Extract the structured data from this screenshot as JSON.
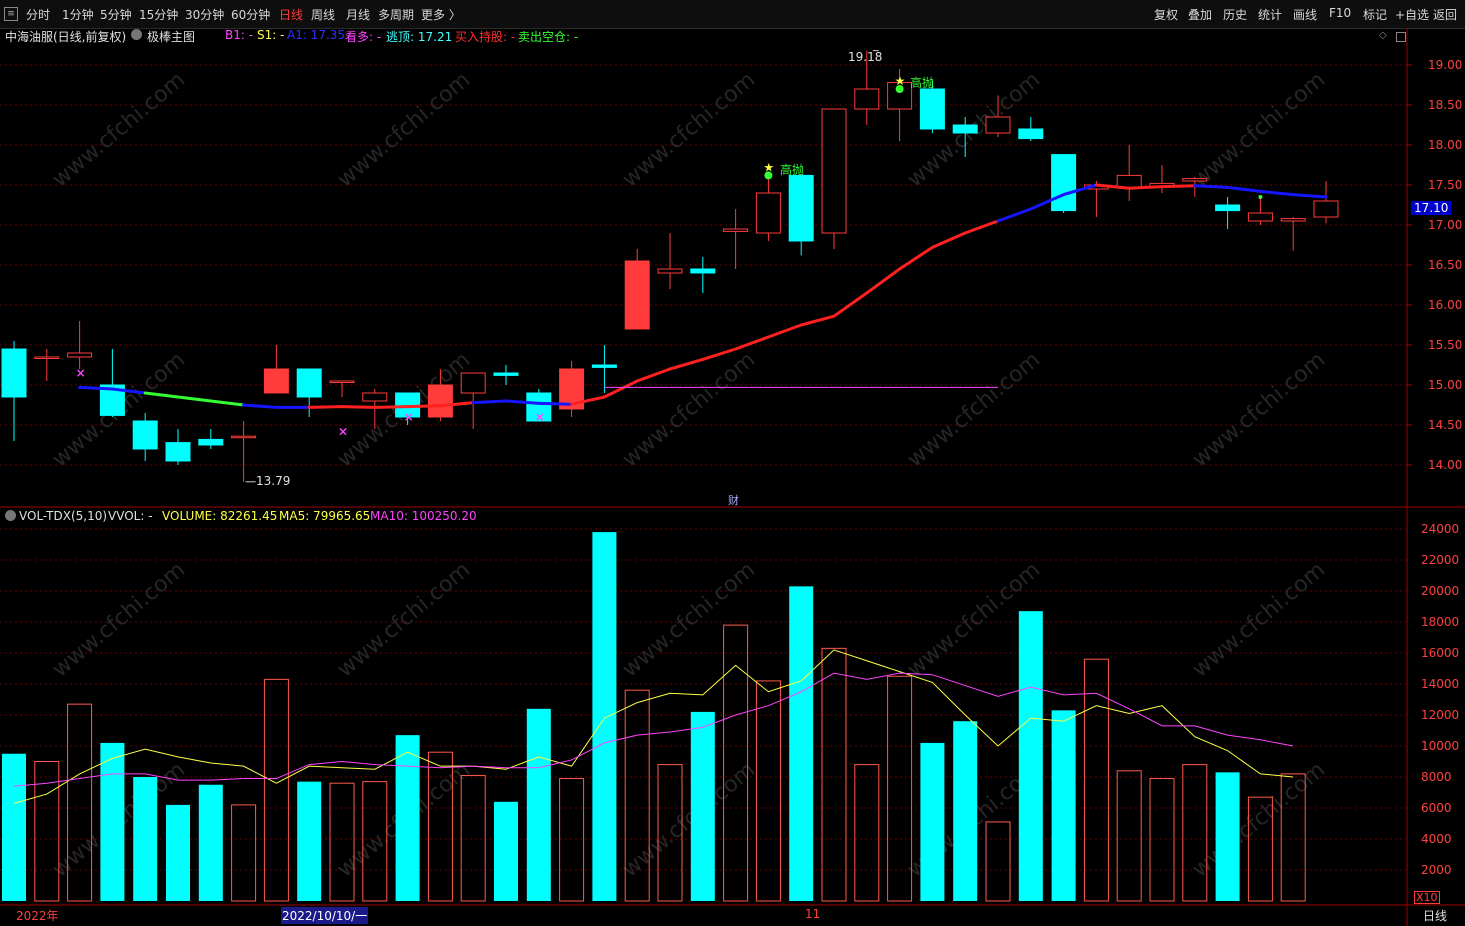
{
  "toolbar": {
    "periods": [
      "分时",
      "1分钟",
      "5分钟",
      "15分钟",
      "30分钟",
      "60分钟",
      "日线",
      "周线",
      "月线",
      "多周期",
      "更多 〉"
    ],
    "active_period": "日线",
    "right_buttons": [
      "复权",
      "叠加",
      "历史",
      "统计",
      "画线",
      "F10",
      "标记",
      "+自选",
      "返回"
    ]
  },
  "main_header": {
    "stock": "中海油服(日线,前复权)",
    "indicator": "极棒主图",
    "b1": "B1: -",
    "s1": "S1: -",
    "a1": "A1: 17.35",
    "kanduo": "看多: -",
    "taoding": "逃顶: 17.21",
    "buy_hold": "买入持股: -",
    "sell_empty": "卖出空仓: -"
  },
  "vol_header": {
    "name": "VOL-TDX(5,10)",
    "vvol": "VVOL: -",
    "volume": "VOLUME: 82261.45",
    "ma5": "MA5: 79965.65",
    "ma10": "MA10: 100250.20"
  },
  "colors": {
    "up": "#ff3b3b",
    "down": "#00ffff",
    "ma_up": "#ff2020",
    "ma_down": "#1515ff",
    "ma_green": "#33ff33",
    "ma5": "#ffff44",
    "ma10": "#ff44ff",
    "grid": "#6a0000"
  },
  "price_axis": [
    "19.00",
    "18.50",
    "18.00",
    "17.50",
    "17.00",
    "16.50",
    "16.00",
    "15.50",
    "15.00",
    "14.50",
    "14.00"
  ],
  "current_price": "17.10",
  "high_label": "19.18",
  "low_label": "13.79",
  "signal_label": "高抛",
  "cai_label": "财",
  "vol_axis": [
    "24000",
    "22000",
    "20000",
    "18000",
    "16000",
    "14000",
    "12000",
    "10000",
    "8000",
    "6000",
    "4000",
    "2000"
  ],
  "vol_unit": "X10",
  "dates": {
    "year": "2022年",
    "selected": "2022/10/10/一",
    "month": "11"
  },
  "bottom_right": "日线",
  "watermark": "www.cfchi.com",
  "chart_data": {
    "type": "candlestick",
    "ylim": [
      13.5,
      19.4
    ],
    "candles": [
      {
        "o": 15.45,
        "c": 14.85,
        "h": 15.55,
        "l": 14.3
      },
      {
        "o": 15.35,
        "c": 15.35,
        "h": 15.45,
        "l": 15.05
      },
      {
        "o": 15.35,
        "c": 15.4,
        "h": 15.8,
        "l": 15.2
      },
      {
        "o": 15.0,
        "c": 14.62,
        "h": 15.45,
        "l": 14.6
      },
      {
        "o": 14.55,
        "c": 14.2,
        "h": 14.65,
        "l": 14.05
      },
      {
        "o": 14.28,
        "c": 14.05,
        "h": 14.45,
        "l": 14.0
      },
      {
        "o": 14.32,
        "c": 14.25,
        "h": 14.45,
        "l": 14.2
      },
      {
        "o": 14.36,
        "c": 14.36,
        "h": 14.55,
        "l": 13.79
      },
      {
        "o": 14.9,
        "c": 15.2,
        "h": 15.5,
        "l": 14.9
      },
      {
        "o": 15.2,
        "c": 14.85,
        "h": 15.2,
        "l": 14.6
      },
      {
        "o": 15.05,
        "c": 15.05,
        "h": 15.05,
        "l": 14.85
      },
      {
        "o": 14.8,
        "c": 14.9,
        "h": 14.95,
        "l": 14.45
      },
      {
        "o": 14.9,
        "c": 14.6,
        "h": 14.9,
        "l": 14.5
      },
      {
        "o": 14.6,
        "c": 15.0,
        "h": 15.2,
        "l": 14.55
      },
      {
        "o": 14.9,
        "c": 15.15,
        "h": 15.15,
        "l": 14.45
      },
      {
        "o": 15.15,
        "c": 15.12,
        "h": 15.25,
        "l": 15.0
      },
      {
        "o": 14.9,
        "c": 14.55,
        "h": 14.95,
        "l": 14.55
      },
      {
        "o": 14.7,
        "c": 15.2,
        "h": 15.3,
        "l": 14.6
      },
      {
        "o": 15.25,
        "c": 15.22,
        "h": 15.5,
        "l": 14.9
      },
      {
        "o": 15.7,
        "c": 16.55,
        "h": 16.7,
        "l": 15.7
      },
      {
        "o": 16.4,
        "c": 16.45,
        "h": 16.9,
        "l": 16.2
      },
      {
        "o": 16.45,
        "c": 16.4,
        "h": 16.6,
        "l": 16.15
      },
      {
        "o": 16.92,
        "c": 16.95,
        "h": 17.2,
        "l": 16.45
      },
      {
        "o": 16.9,
        "c": 17.4,
        "h": 17.65,
        "l": 16.8
      },
      {
        "o": 17.62,
        "c": 16.8,
        "h": 17.62,
        "l": 16.62
      },
      {
        "o": 16.9,
        "c": 18.45,
        "h": 18.45,
        "l": 16.7
      },
      {
        "o": 18.45,
        "c": 18.7,
        "h": 19.18,
        "l": 18.25
      },
      {
        "o": 18.45,
        "c": 18.78,
        "h": 18.95,
        "l": 18.05
      },
      {
        "o": 18.7,
        "c": 18.2,
        "h": 18.8,
        "l": 18.15
      },
      {
        "o": 18.25,
        "c": 18.15,
        "h": 18.35,
        "l": 17.85
      },
      {
        "o": 18.15,
        "c": 18.35,
        "h": 18.62,
        "l": 18.1
      },
      {
        "o": 18.2,
        "c": 18.08,
        "h": 18.35,
        "l": 18.05
      },
      {
        "o": 17.88,
        "c": 17.18,
        "h": 17.88,
        "l": 17.15
      },
      {
        "o": 17.45,
        "c": 17.5,
        "h": 17.55,
        "l": 17.1
      },
      {
        "o": 17.47,
        "c": 17.62,
        "h": 18.0,
        "l": 17.3
      },
      {
        "o": 17.48,
        "c": 17.52,
        "h": 17.75,
        "l": 17.4
      },
      {
        "o": 17.55,
        "c": 17.58,
        "h": 17.6,
        "l": 17.35
      },
      {
        "o": 17.25,
        "c": 17.18,
        "h": 17.35,
        "l": 16.95
      },
      {
        "o": 17.05,
        "c": 17.15,
        "h": 17.35,
        "l": 17.0
      },
      {
        "o": 17.05,
        "c": 17.08,
        "h": 17.1,
        "l": 16.68
      },
      {
        "o": 17.1,
        "c": 17.3,
        "h": 17.55,
        "l": 17.02
      }
    ],
    "ma_line": [
      14.85,
      null,
      14.97,
      14.95,
      14.9,
      14.85,
      14.8,
      14.75,
      14.72,
      14.72,
      14.73,
      14.72,
      14.73,
      14.74,
      14.78,
      14.8,
      14.77,
      14.76,
      14.85,
      15.05,
      15.2,
      15.32,
      15.45,
      15.6,
      15.75,
      15.86,
      16.15,
      16.45,
      16.72,
      16.9,
      17.05,
      17.2,
      17.38,
      17.5,
      17.46,
      17.48,
      17.49,
      17.47,
      17.42,
      17.38,
      17.35
    ],
    "volumes": [
      9500,
      9000,
      12700,
      10200,
      8000,
      6200,
      7500,
      6200,
      14300,
      7700,
      7600,
      7700,
      10700,
      9600,
      8100,
      6400,
      12400,
      7900,
      23800,
      13600,
      8800,
      12200,
      17800,
      14200,
      20300,
      16300,
      8800,
      14500,
      10200,
      11600,
      5100,
      18700,
      12300,
      15600,
      8400,
      7900,
      8800,
      8300,
      6700,
      8200
    ],
    "ma5": [
      6300,
      6900,
      8200,
      9200,
      9800,
      9300,
      8900,
      8700,
      7600,
      8700,
      8600,
      8500,
      9600,
      8700,
      8700,
      8500,
      9300,
      8700,
      11800,
      12800,
      13400,
      13300,
      15200,
      13500,
      14200,
      16200,
      15500,
      14800,
      14100,
      12000,
      10000,
      11800,
      11600,
      12600,
      12100,
      12600,
      10600,
      9700,
      8200,
      8000
    ],
    "ma10": [
      7400,
      7600,
      7900,
      8200,
      8200,
      7800,
      7800,
      7900,
      7900,
      8800,
      9000,
      8800,
      8700,
      8600,
      8700,
      8600,
      8600,
      9100,
      10200,
      10700,
      10900,
      11200,
      12000,
      12600,
      13500,
      14700,
      14300,
      14700,
      14600,
      13900,
      13200,
      13800,
      13300,
      13400,
      12400,
      11300,
      11300,
      10700,
      10400,
      10000
    ],
    "vol_ylim": [
      0,
      25000
    ]
  }
}
